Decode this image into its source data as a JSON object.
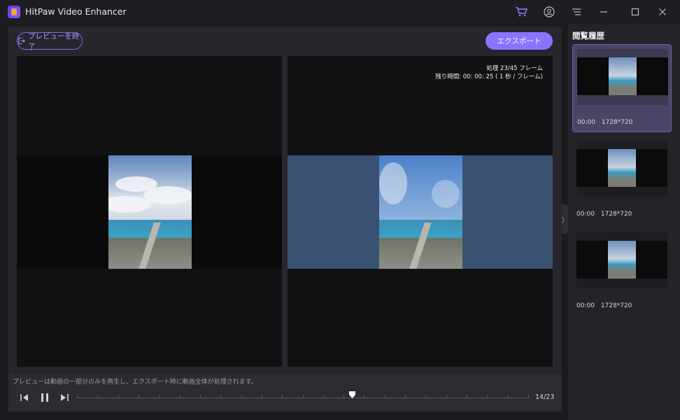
{
  "window": {
    "title": "HitPaw Video Enhancer"
  },
  "titlebar_icons": [
    "cart-icon",
    "account-icon",
    "menu-icon",
    "minimize-icon",
    "maximize-icon",
    "close-icon"
  ],
  "toolbar": {
    "end_preview_label": "プレビューを終了",
    "export_label": "エクスポート"
  },
  "preview": {
    "processing_line1": "処理 23/45 フレーム",
    "processing_line2": "残り時間: 00: 00: 25 ( 1 秒 / フレーム)"
  },
  "player": {
    "hint": "プレビューは動画の一部分のみを再生し、エクスポート時に動画全体が処理されます。",
    "counter": "14/23",
    "progress_fraction": 0.61
  },
  "sidebar": {
    "title": "閲覧履歴",
    "items": [
      {
        "time": "00:00",
        "resolution": "1728*720"
      },
      {
        "time": "00:00",
        "resolution": "1728*720"
      },
      {
        "time": "00:00",
        "resolution": "1728*720"
      }
    ]
  },
  "colors": {
    "accent": "#8c73ff",
    "enhanced_bg": "#3a5272",
    "panel": "#26262c"
  }
}
